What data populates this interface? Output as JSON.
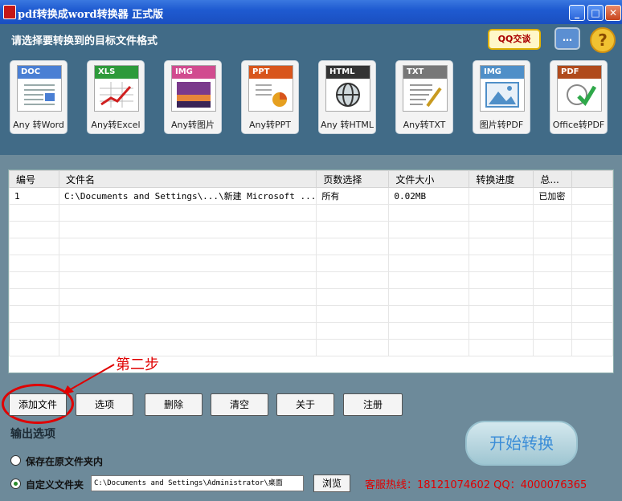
{
  "window": {
    "title": "pdf转换成word转换器 正式版",
    "min": "_",
    "max": "□",
    "close": "✕"
  },
  "header": {
    "instruction": "请选择要转换到的目标文件格式",
    "qq_label": "QQ交谈",
    "chat_glyph": "…",
    "help_glyph": "?"
  },
  "formats": [
    {
      "tag": "DOC",
      "label": "Any 转Word",
      "color": "#4a7fd4"
    },
    {
      "tag": "XLS",
      "label": "Any转Excel",
      "color": "#2d9a3a"
    },
    {
      "tag": "IMG",
      "label": "Any转图片",
      "color": "#d14b8f"
    },
    {
      "tag": "PPT",
      "label": "Any转PPT",
      "color": "#d8551c"
    },
    {
      "tag": "HTML",
      "label": "Any 转HTML",
      "color": "#333333"
    },
    {
      "tag": "TXT",
      "label": "Any转TXT",
      "color": "#777777"
    },
    {
      "tag": "IMG",
      "label": "图片转PDF",
      "color": "#4f8fc8"
    },
    {
      "tag": "PDF",
      "label": "Office转PDF",
      "color": "#b04a1c"
    }
  ],
  "file_list": {
    "columns": [
      "编号",
      "文件名",
      "页数选择",
      "文件大小",
      "转换进度",
      "总..."
    ],
    "rows": [
      [
        "1",
        "C:\\Documents and Settings\\...\\新建 Microsoft ...",
        "所有",
        "0.02MB",
        "",
        "已加密"
      ]
    ]
  },
  "annotation": {
    "step_text": "第二步"
  },
  "buttons": {
    "add": "添加文件",
    "options": "选项",
    "delete": "删除",
    "clear": "清空",
    "about": "关于",
    "register": "注册",
    "browse": "浏览",
    "start": "开始转换"
  },
  "output": {
    "title": "输出选项",
    "option1": "保存在原文件夹内",
    "option2": "自定义文件夹",
    "path": "C:\\Documents and Settings\\Administrator\\桌面",
    "selected": "option2"
  },
  "hotline": "客服热线：18121074602 QQ：4000076365",
  "colors": {
    "accent": "#e00000",
    "header_bg": "#416b87",
    "body_bg": "#6d8a9a"
  }
}
